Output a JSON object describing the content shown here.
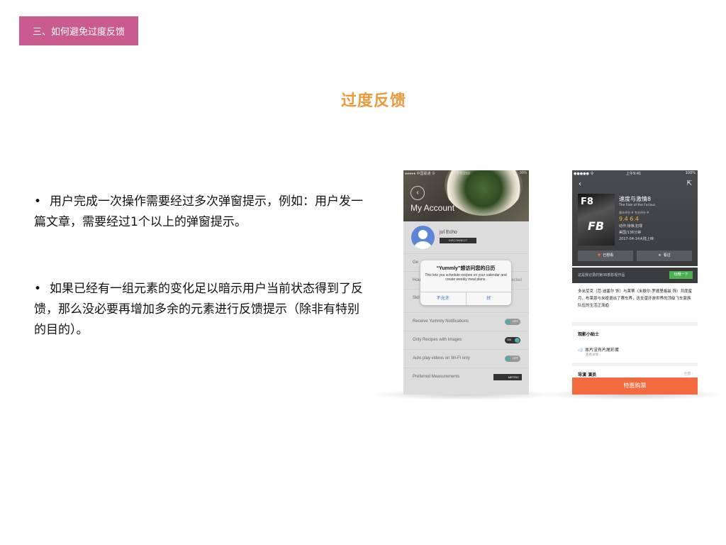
{
  "section_tag": "三、如何避免过度反馈",
  "title": "过度反馈",
  "bullets": [
    "用户完成一次操作需要经过多次弹窗提示，例如：用户发一篇文章，需要经过1个以上的弹窗提示。",
    "如果已经有一组元素的变化足以暗示用户当前状态得到了反馈，那么没必要再增加多余的元素进行反馈提示（除非有特别的目的）。"
  ],
  "bullet_symbol": "•",
  "phone1": {
    "status_left": "●●●●● 中国联通 令",
    "status_time": "下午3:50",
    "status_right": "90%",
    "back_icon": "‹",
    "header_title": "My Account",
    "user_name": "jul Echo",
    "disconnect_label": "DISCONNECT",
    "bg_labels": [
      "Ge",
      "Hou",
      "Skil"
    ],
    "bg_right": "ected",
    "dialog": {
      "title": "“Yummly”想访问您的日历",
      "message": "This lets you schedule recipes on your calendar and create weekly meal plans.",
      "deny": "不允许",
      "allow": "好"
    },
    "rows": [
      {
        "label": "Receive Yummly Notifications",
        "state": "OFF"
      },
      {
        "label": "Only Recipes with Images",
        "state": "ON"
      },
      {
        "label": "Auto play videos on Wi-Fi only",
        "state": "OFF"
      }
    ],
    "measurements_label": "Preferred Measurements",
    "metric_label": "METRIC"
  },
  "phone2": {
    "status_left": "●●●●● 令",
    "status_time": "上午9:41",
    "status_right": "100%",
    "back_icon": "‹",
    "share_icon": "⇱",
    "poster_text": "F8",
    "poster_sub": "FB",
    "movie_name": "速度与激情8",
    "movie_en": "The Fate of the Furious",
    "score_labels": "观众评分 ※            专业评分 ※",
    "scores": "9.4                  6.4",
    "meta": [
      "动作,惊悚,犯罪",
      "美国/136分钟",
      "2017-04-14大陆上映"
    ],
    "want_label": "已想看",
    "seen_label": "看过",
    "band_text": "这是我记录的第36部影视作品",
    "band_button": "玩哦一下",
    "description": "多米尼克（范·迪塞尔 饰）与莱蒂（米歇尔·罗德里格兹 饰）共度蜜月，布莱恩与米娅退出了赛车界，这支曾环游世界的顶级飞车家族队伍的生活正渐趋",
    "tips_title": "观影小贴士",
    "trailer_title": "本片没有片尾彩蛋",
    "trailer_sub": "查看详情 ›",
    "crew_label": "导演           演员",
    "all_label": "全部 ›",
    "buy_label": "特惠购票"
  }
}
